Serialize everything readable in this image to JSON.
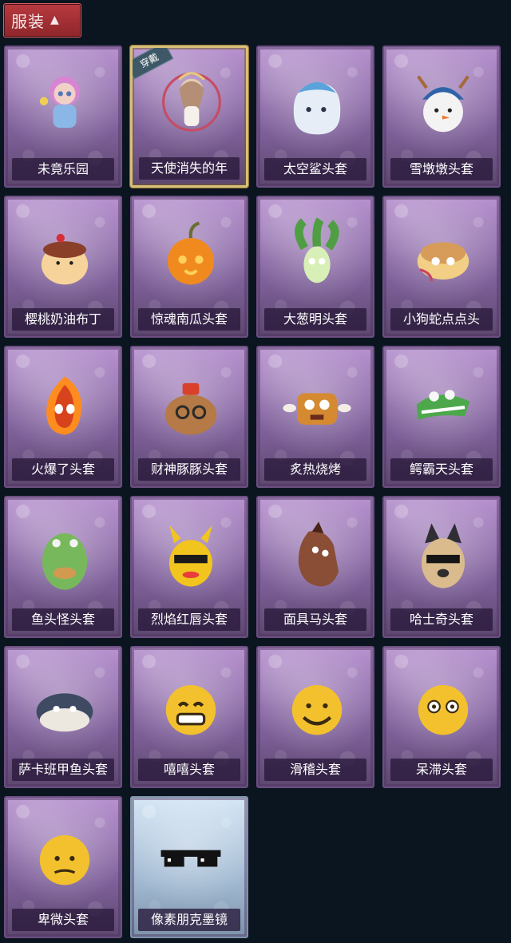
{
  "header": {
    "title": "服装"
  },
  "items": [
    {
      "label": "未竟乐园",
      "icon": "doll-icon"
    },
    {
      "label": "天使消失的年",
      "icon": "angel-doll-icon",
      "badge": "穿戴"
    },
    {
      "label": "太空鲨头套",
      "icon": "shark-helmet-icon"
    },
    {
      "label": "雪墩墩头套",
      "icon": "snow-reindeer-helmet-icon"
    },
    {
      "label": "樱桃奶油布丁",
      "icon": "pudding-helmet-icon"
    },
    {
      "label": "惊魂南瓜头套",
      "icon": "pumpkin-helmet-icon"
    },
    {
      "label": "大葱明头套",
      "icon": "scallion-helmet-icon"
    },
    {
      "label": "小狗蛇点点头",
      "icon": "snake-dog-helmet-icon"
    },
    {
      "label": "火爆了头套",
      "icon": "fireball-helmet-icon"
    },
    {
      "label": "财神豚豚头套",
      "icon": "capybara-helmet-icon"
    },
    {
      "label": "炙热烧烤",
      "icon": "grilled-meat-helmet-icon"
    },
    {
      "label": "鳄霸天头套",
      "icon": "crocodile-helmet-icon"
    },
    {
      "label": "鱼头怪头套",
      "icon": "fish-head-helmet-icon"
    },
    {
      "label": "烈焰红唇头套",
      "icon": "yellow-mask-helmet-icon"
    },
    {
      "label": "面具马头套",
      "icon": "horse-mask-helmet-icon"
    },
    {
      "label": "哈士奇头套",
      "icon": "husky-helmet-icon"
    },
    {
      "label": "萨卡班甲鱼头套",
      "icon": "fish-helmet-icon"
    },
    {
      "label": "嘻嘻头套",
      "icon": "grin-emoji-helmet-icon"
    },
    {
      "label": "滑稽头套",
      "icon": "funny-emoji-helmet-icon"
    },
    {
      "label": "呆滞头套",
      "icon": "blank-emoji-helmet-icon"
    },
    {
      "label": "卑微头套",
      "icon": "humble-emoji-helmet-icon"
    },
    {
      "label": "像素朋克墨镜",
      "icon": "pixel-sunglasses-icon"
    }
  ]
}
